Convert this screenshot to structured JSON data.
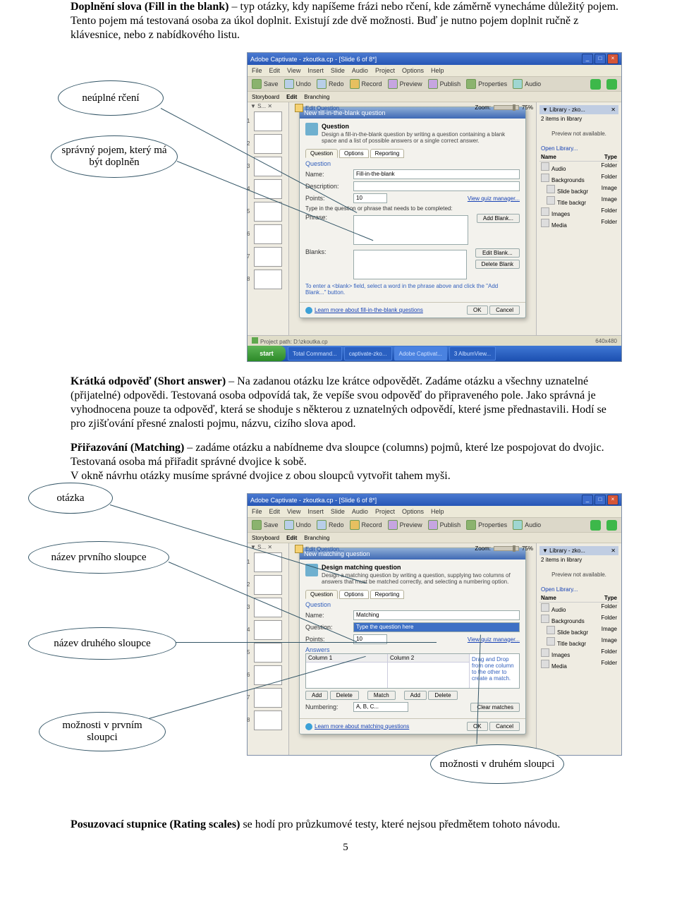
{
  "intro": {
    "p1_a": "Doplnění slova (Fill in the blank)",
    "p1_b": " – typ otázky, kdy napíšeme frázi nebo rčení, kde záměrně vynecháme důležitý pojem. Tento pojem má testovaná osoba za úkol doplnit. Existují zde dvě možnosti. Buď je nutno pojem doplnit ručně z klávesnice, nebo z nabídkového listu."
  },
  "callouts1": {
    "a": "neúplné rčení",
    "b": "správný pojem, který má být doplněn"
  },
  "shot_common": {
    "title": "Adobe Captivate - zkoutka.cp - [Slide 6 of 8*]",
    "menu": [
      "File",
      "Edit",
      "View",
      "Insert",
      "Slide",
      "Audio",
      "Project",
      "Options",
      "Help"
    ],
    "toolbar": {
      "save": "Save",
      "undo": "Undo",
      "redo": "Redo",
      "record": "Record",
      "preview": "Preview",
      "publish": "Publish",
      "properties": "Properties",
      "audio": "Audio"
    },
    "tabs": {
      "story": "Storyboard",
      "edit": "Edit",
      "branch": "Branching"
    },
    "editq": "Edit Question...",
    "zoom_label": "Zoom:",
    "zoom_val": "75%",
    "lib_head": "Library - zko...",
    "lib_sub": "2 items in library",
    "preview_na": "Preview not available.",
    "openlib": "Open Library...",
    "lib_cols": {
      "name": "Name",
      "type": "Type"
    },
    "lib_rows": [
      {
        "n": "Audio",
        "t": "Folder"
      },
      {
        "n": "Backgrounds",
        "t": "Folder"
      },
      {
        "n": "Slide backgr",
        "t": "Image"
      },
      {
        "n": "Title backgr",
        "t": "Image"
      },
      {
        "n": "Images",
        "t": "Folder"
      },
      {
        "n": "Media",
        "t": "Folder"
      }
    ],
    "status_path": "Project path: D:\\zkoutka.cp",
    "status_dim": "640x480",
    "start": "start",
    "tray": [
      "Total Command...",
      "captivate-zko...",
      "Adobe Captivat...",
      "3 AlbumView..."
    ]
  },
  "shot1": {
    "dlg_title": "New fill-in-the-blank question",
    "sub1": "Question",
    "sub2": "Design a fill-in-the-blank question by writing a question containing a blank space and a list of possible answers or a single correct answer.",
    "tabs": [
      "Question",
      "Options",
      "Reporting"
    ],
    "sect_q": "Question",
    "name_l": "Name:",
    "name_v": "Fill-in-the-blank",
    "desc_l": "Description:",
    "points_l": "Points:",
    "points_v": "10",
    "viewqm": "View quiz manager...",
    "type_hint": "Type in the question or phrase that needs to be completed:",
    "phrase_l": "Phrase:",
    "addblank": "Add Blank...",
    "blanks_l": "Blanks:",
    "editblank": "Edit Blank...",
    "delblank": "Delete Blank",
    "hint": "To enter a <blank> field, select a word in the phrase above and click the \"Add Blank...\" button.",
    "learn": "Learn more about fill-in-the-blank questions",
    "ok": "OK",
    "cancel": "Cancel"
  },
  "mid": {
    "p2_a": "Krátká odpověď (Short answer)",
    "p2_b": " – Na zadanou otázku lze krátce odpovědět. Zadáme otázku a všechny uznatelné (přijatelné) odpovědi. Testovaná osoba odpovídá tak, že vepíše svou odpověď do připraveného pole. Jako správná je vyhodnocena pouze ta odpověď, která se shoduje s některou z uznatelných odpovědí, které jsme přednastavili. Hodí se pro zjišťování přesné znalosti pojmu, názvu, cizího slova apod.",
    "p3_a": "Přiřazování (Matching)",
    "p3_b": " – zadáme otázku a nabídneme dva sloupce (columns) pojmů, které lze pospojovat do dvojic. Testovaná osoba má přiřadit správné dvojice k sobě.",
    "p3_c": "V okně návrhu otázky musíme správné dvojice z obou sloupců vytvořit tahem myši."
  },
  "callouts2": {
    "a": "otázka",
    "b": "název prvního sloupce",
    "c": "název druhého sloupce",
    "d": "možnosti v prvním sloupci",
    "e": "možnosti v druhém sloupci"
  },
  "shot2": {
    "dlg_title": "New matching question",
    "sub1": "Design matching question",
    "sub2": "Design a matching question by writing a question, supplying two columns of answers that must be matched correctly, and selecting a numbering option.",
    "tabs": [
      "Question",
      "Options",
      "Reporting"
    ],
    "sect_q": "Question",
    "name_l": "Name:",
    "name_v": "Matching",
    "q_l": "Question:",
    "q_v": "Type the question here",
    "points_l": "Points:",
    "points_v": "10",
    "viewqm": "View quiz manager...",
    "ans_l": "Answers",
    "col1": "Column 1",
    "col2": "Column 2",
    "drag": "Drag and Drop from one column to the other to create a match.",
    "add": "Add",
    "del": "Delete",
    "match": "Match",
    "num_l": "Numbering:",
    "num_v": "A, B, C...",
    "clear": "Clear matches",
    "learn": "Learn more about matching questions",
    "ok": "OK",
    "cancel": "Cancel"
  },
  "outro": {
    "p4_a": "Posuzovací stupnice (Rating scales)",
    "p4_b": " se hodí pro průzkumové testy, které nejsou předmětem tohoto návodu."
  },
  "page_number": "5"
}
